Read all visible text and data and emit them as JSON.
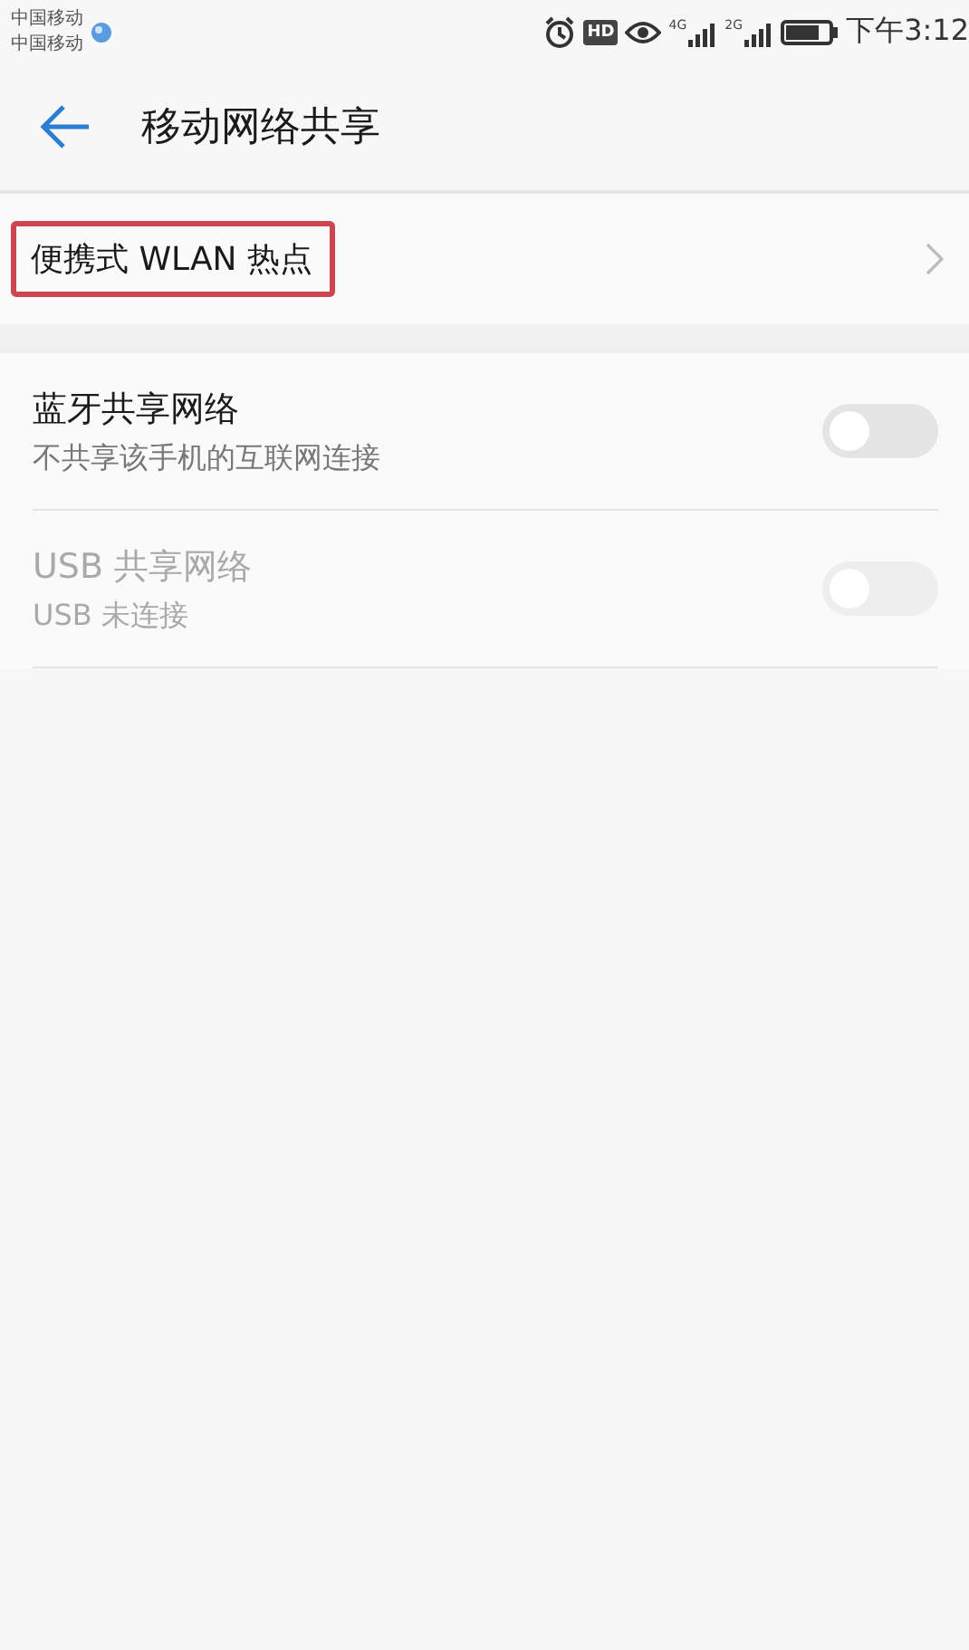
{
  "status_bar": {
    "carriers": [
      "中国移动",
      "中国移动"
    ],
    "hd_badge": "HD",
    "signals": [
      "4G",
      "2G"
    ],
    "time": "下午3:12"
  },
  "header": {
    "title": "移动网络共享"
  },
  "link_item": {
    "label": "便携式 WLAN 热点",
    "highlighted": true
  },
  "toggles": [
    {
      "title": "蓝牙共享网络",
      "subtitle": "不共享该手机的互联网连接",
      "on": false,
      "disabled": false
    },
    {
      "title": "USB 共享网络",
      "subtitle": "USB 未连接",
      "on": false,
      "disabled": true
    }
  ]
}
